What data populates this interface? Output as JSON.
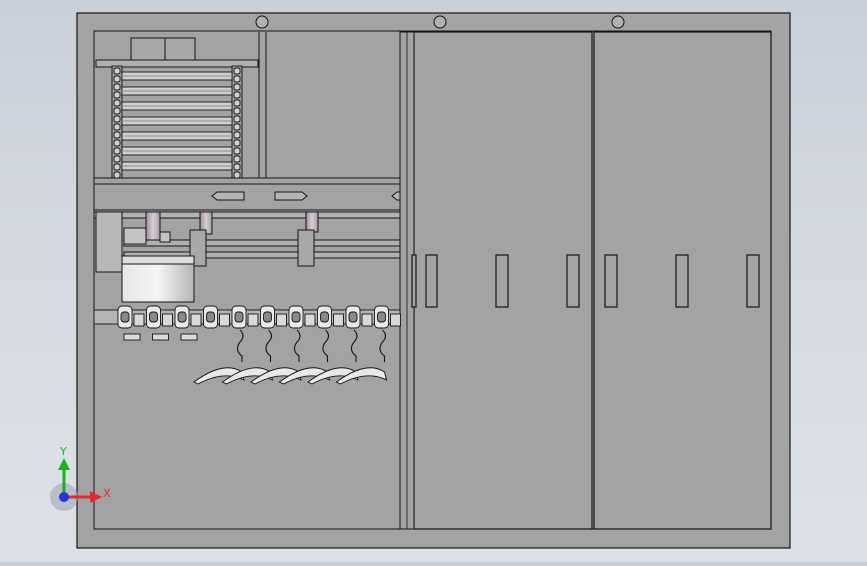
{
  "viewport": {
    "background_top": "#c9cfd9",
    "background_bottom": "#dde1e7"
  },
  "model": {
    "panel_color": "#a3a3a3",
    "edge_color": "#141414",
    "highlight_color": "#cfcfcf",
    "part_color": "#bdbdbd",
    "pink_tint": "#c8bcc6",
    "door_handle_count": 6,
    "lifting_eye_count": 3,
    "hook_count": 10,
    "rack_slat_count": 7
  },
  "triad": {
    "x_label": "X",
    "y_label": "Y",
    "x_color": "#e8262b",
    "y_color": "#19b31b",
    "z_color": "#2338d6"
  }
}
